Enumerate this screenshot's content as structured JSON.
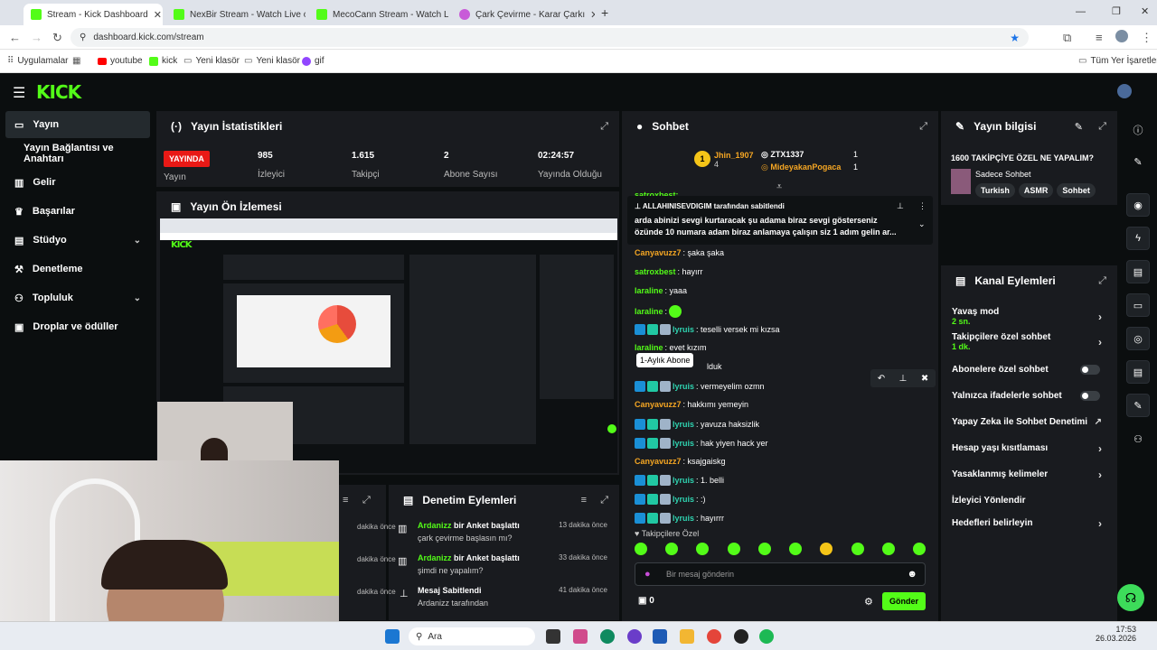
{
  "browser": {
    "tabs": [
      {
        "title": "Stream - Kick Dashboard"
      },
      {
        "title": "NexBir Stream - Watch Live on"
      },
      {
        "title": "MecoCann Stream - Watch Live"
      },
      {
        "title": "Çark Çevirme - Karar Çarkı"
      }
    ],
    "url": "dashboard.kick.com/stream",
    "bookmarks": [
      "Uygulamalar",
      "youtube",
      "kick",
      "Yeni klasör",
      "Yeni klasör",
      "gif"
    ],
    "all_bookmarks": "Tüm Yer İşaretleri"
  },
  "kick": {
    "logo": "KICK",
    "sidebar": [
      {
        "label": "Yayın",
        "active": true
      },
      {
        "label": "Yayın Bağlantısı ve Anahtarı"
      },
      {
        "label": "Gelir"
      },
      {
        "label": "Başarılar"
      },
      {
        "label": "Stüdyo",
        "chevron": true
      },
      {
        "label": "Denetleme"
      },
      {
        "label": "Topluluk",
        "chevron": true
      },
      {
        "label": "Droplar ve ödüller"
      }
    ],
    "stats": {
      "title": "Yayın İstatistikleri",
      "live": "YAYINDA",
      "live_label": "Yayın",
      "viewers": "985",
      "viewers_label": "İzleyici",
      "followers": "1.615",
      "followers_label": "Takipçi",
      "subs": "2",
      "subs_label": "Abone Sayısı",
      "uptime": "02:24:57",
      "uptime_label": "Yayında Olduğu"
    },
    "preview": {
      "title": "Yayın Ön İzlemesi"
    },
    "modlog": {
      "title": "Denetim Eylemleri",
      "items": [
        {
          "actor": "Ardanizz",
          "action": "bir Anket başlattı",
          "detail": "çark çevirme başlasın mı?",
          "time": "13 dakika önce"
        },
        {
          "actor": "Ardanizz",
          "action": "bir Anket başlattı",
          "detail": "şimdi ne yapalım?",
          "time": "33 dakika önce"
        },
        {
          "actor": "Mesaj Sabitlendi",
          "action": "",
          "detail": "Ardanizz tarafından",
          "time": "41 dakika önce"
        }
      ],
      "left_times": [
        "dakika önce",
        "dakika önce",
        "dakika önce"
      ]
    },
    "chat": {
      "title": "Sohbet",
      "top1": {
        "name": "Jhin_1907",
        "count": "4"
      },
      "top2": {
        "name": "ZTX1337",
        "count": "1"
      },
      "top3": {
        "name": "MideyakanPogaca",
        "count": "1"
      },
      "pinned_by": "ALLAHINISEVDIGIM tarafından sabitlendi",
      "pinned_text": "arda abinizi sevgi kurtaracak şu adama biraz sevgi gösterseniz özünde 10 numara adam biraz anlamaya çalışın siz 1 adım gelin ar...",
      "partial_top": "satroxbest:",
      "tooltip": "1-Aylık Abone",
      "messages": [
        {
          "user": "Canyavuzz7",
          "text": ": şaka şaka",
          "color": "orange",
          "badges": false
        },
        {
          "user": "satroxbest",
          "text": ": hayırr",
          "color": "green",
          "badges": false
        },
        {
          "user": "laraline",
          "text": ": yaaa",
          "color": "green",
          "badges": false
        },
        {
          "user": "laraline",
          "text": ":",
          "color": "green",
          "badges": false,
          "emote": true
        },
        {
          "user": "lyruis",
          "text": ": teselli versek mi kızsa",
          "color": "teal",
          "badges": true
        },
        {
          "user": "laraline",
          "text": ": evet kızım",
          "color": "green",
          "badges": false
        },
        {
          "user": "",
          "text": "lduk",
          "color": "green",
          "badges": false
        },
        {
          "user": "lyruis",
          "text": ": vermeyelim ozmn",
          "color": "teal",
          "badges": true
        },
        {
          "user": "Canyavuzz7",
          "text": ": hakkımı yemeyin",
          "color": "orange",
          "badges": false
        },
        {
          "user": "lyruis",
          "text": ": yavuza haksizlik",
          "color": "teal",
          "badges": true
        },
        {
          "user": "lyruis",
          "text": ": hak yiyen hack yer",
          "color": "teal",
          "badges": true
        },
        {
          "user": "Canyavuzz7",
          "text": ": ksajgaiskg",
          "color": "orange",
          "badges": false
        },
        {
          "user": "lyruis",
          "text": ": 1. belli",
          "color": "teal",
          "badges": true
        },
        {
          "user": "lyruis",
          "text": ": :)",
          "color": "teal",
          "badges": true
        },
        {
          "user": "lyruis",
          "text": ": hayırrr",
          "color": "teal",
          "badges": true
        }
      ],
      "followers_only": "Takipçilere Özel",
      "placeholder": "Bir mesaj gönderin",
      "points": "0",
      "send": "Gönder"
    },
    "info": {
      "title": "Yayın bilgisi",
      "stream_title": "1600 TAKİPÇİYE ÖZEL NE YAPALIM?",
      "category": "Sadece Sohbet",
      "tags": [
        "Turkish",
        "ASMR",
        "Sohbet"
      ]
    },
    "actions": {
      "title": "Kanal Eylemleri",
      "items": [
        {
          "label": "Yavaş mod",
          "sub": "2 sn.",
          "kind": "chevron"
        },
        {
          "label": "Takipçilere özel sohbet",
          "sub": "1 dk.",
          "kind": "chevron"
        },
        {
          "label": "Abonelere özel sohbet",
          "sub": "",
          "kind": "toggle"
        },
        {
          "label": "Yalnızca ifadelerle sohbet",
          "sub": "",
          "kind": "toggle"
        },
        {
          "label": "Yapay Zeka ile Sohbet Denetimi",
          "sub": "",
          "kind": "link"
        },
        {
          "label": "Hesap yaşı kısıtlaması",
          "sub": "",
          "kind": "chevron"
        },
        {
          "label": "Yasaklanmış kelimeler",
          "sub": "",
          "kind": "chevron"
        },
        {
          "label": "İzleyici Yönlendir",
          "sub": "",
          "kind": "none"
        },
        {
          "label": "Hedefleri belirleyin",
          "sub": "",
          "kind": "chevron"
        }
      ]
    }
  },
  "taskbar": {
    "search": "Ara",
    "time": "17:53",
    "date": "26.03.2026"
  },
  "colors": {
    "kick_green": "#53fc18",
    "panel": "#191b1f",
    "bg": "#0b0e0f",
    "live_red": "#e91916"
  }
}
